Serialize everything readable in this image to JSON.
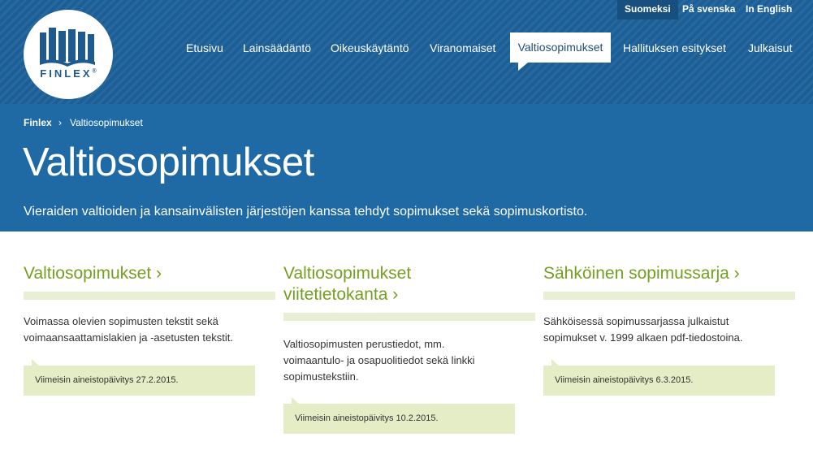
{
  "logo": {
    "text": "FINLEX",
    "mark": "®"
  },
  "languages": [
    "Suomeksi",
    "På svenska",
    "In English"
  ],
  "nav": [
    "Etusivu",
    "Lainsäädäntö",
    "Oikeuskäytäntö",
    "Viranomaiset",
    "Valtiosopimukset",
    "Hallituksen esitykset",
    "Julkaisut"
  ],
  "breadcrumb": {
    "home": "Finlex",
    "sep": "›",
    "current": "Valtiosopimukset"
  },
  "page": {
    "title": "Valtiosopimukset",
    "subtitle": "Vieraiden valtioiden ja kansainvälisten järjestöjen kanssa tehdyt sopimukset sekä sopimuskortisto."
  },
  "columns": [
    {
      "title_lines": [
        "Valtiosopimukset ›"
      ],
      "text_lines": [
        "Voimassa olevien sopimusten tekstit sekä",
        "voimaansaattamislakien ja -asetusten tekstit."
      ],
      "update": "Viimeisin aineistopäivitys 27.2.2015."
    },
    {
      "title_lines": [
        "Valtiosopimukset",
        "viitetietokanta ›"
      ],
      "text_lines": [
        "Valtiosopimusten perustiedot, mm.",
        "voimaantulo- ja osapuolitiedot sekä linkki",
        "sopimustekstiin."
      ],
      "update": "Viimeisin aineistopäivitys 10.2.2015."
    },
    {
      "title_lines": [
        "Sähköinen sopimussarja ›"
      ],
      "text_lines": [
        "Sähköisessä sopimussarjassa julkaistut",
        "sopimukset v. 1999 alkaen pdf-tiedostoina."
      ],
      "update": "Viimeisin aineistopäivitys 6.3.2015."
    }
  ],
  "colors": {
    "header": "#1c5f97",
    "hero": "#1f6aa5",
    "accent": "#74a020",
    "update_bg": "#e4edc6"
  }
}
